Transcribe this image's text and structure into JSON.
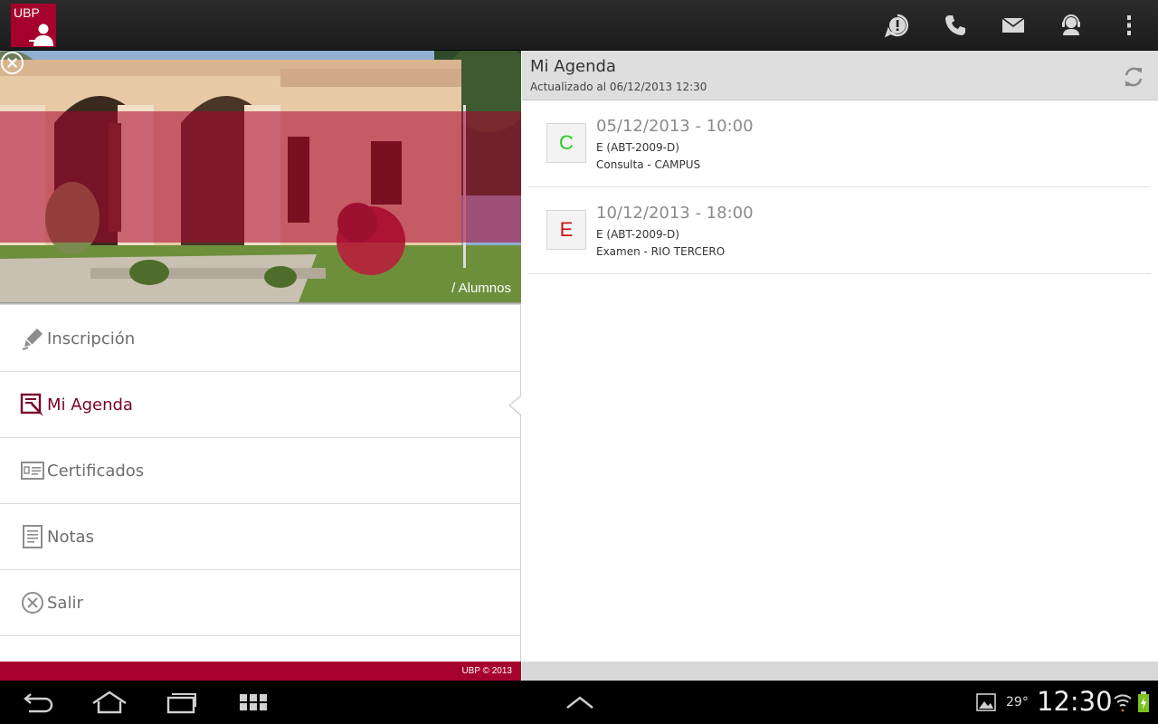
{
  "app": {
    "logo_text": "UBP",
    "actions": [
      "alert-icon",
      "phone-icon",
      "mail-icon",
      "support-agent-icon",
      "overflow-menu-icon"
    ]
  },
  "drawer": {
    "hero_caption": "/ Alumnos",
    "menu": [
      {
        "label": "Inscripción",
        "icon": "pencil-icon",
        "active": false
      },
      {
        "label": "Mi Agenda",
        "icon": "agenda-icon",
        "active": true
      },
      {
        "label": "Certificados",
        "icon": "certificate-icon",
        "active": false
      },
      {
        "label": "Notas",
        "icon": "notes-icon",
        "active": false
      },
      {
        "label": "Salir",
        "icon": "exit-icon",
        "active": false
      }
    ],
    "footer": "UBP © 2013"
  },
  "agenda": {
    "title": "Mi Agenda",
    "updated": "Actualizado al 06/12/2013 12:30",
    "items": [
      {
        "badge": "C",
        "badge_color": "#22cc22",
        "datetime": "05/12/2013 - 10:00",
        "code": "E (ABT-2009-D)",
        "description": "Consulta - CAMPUS"
      },
      {
        "badge": "E",
        "badge_color": "#cc1111",
        "datetime": "10/12/2013 - 18:00",
        "code": "E (ABT-2009-D)",
        "description": "Examen - RIO TERCERO"
      }
    ]
  },
  "system": {
    "temperature": "29°",
    "clock": "12:30"
  },
  "colors": {
    "brand": "#a6002c",
    "active_text": "#7a0025"
  }
}
